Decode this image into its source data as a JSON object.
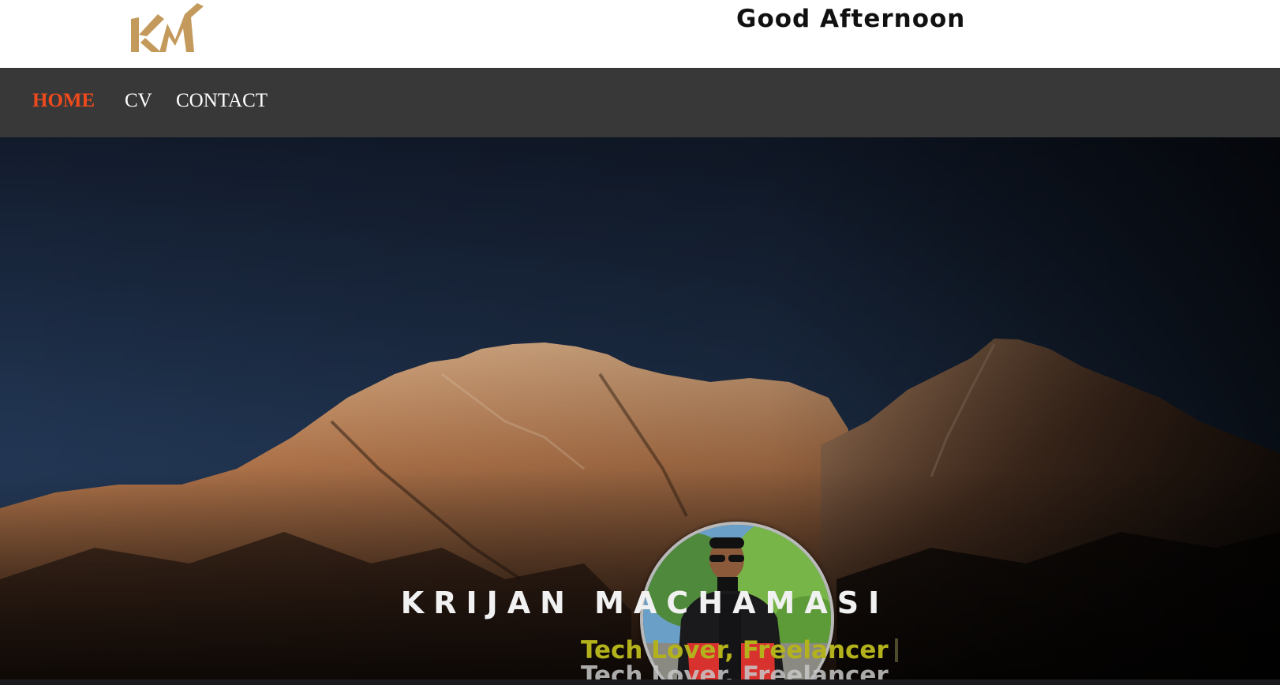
{
  "header": {
    "logo_text": "KM",
    "greeting": "Good Afternoon"
  },
  "nav": {
    "items": [
      {
        "label": "HOME",
        "active": true
      },
      {
        "label": "CV",
        "active": false
      },
      {
        "label": "CONTACT",
        "active": false
      }
    ]
  },
  "hero": {
    "name": "KRIJAN MACHAMASI",
    "tagline": "Tech Lover, Freelancer",
    "tagline_reflection": "Tech Lover, Freelancer",
    "avatar_icon": "profile-photo"
  },
  "colors": {
    "accent": "#f04a1c",
    "tagline": "#b3b21c",
    "nav_bg": "#383838",
    "logo_gold": "#c49a5c",
    "sky_top": "#162033",
    "sky_bottom": "#23395a"
  }
}
